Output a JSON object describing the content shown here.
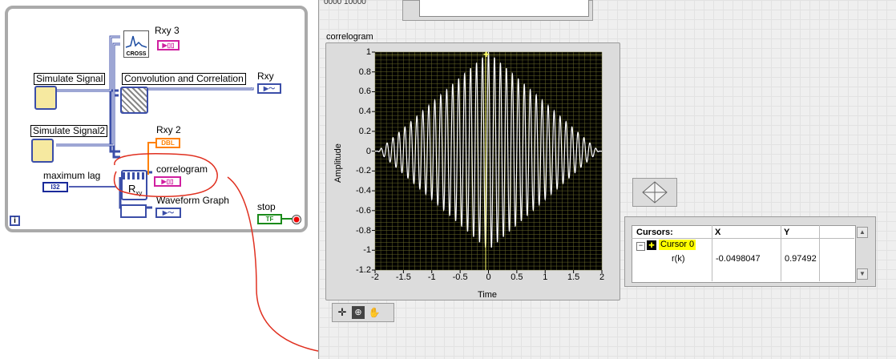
{
  "block_diagram": {
    "simulate_signal": "Simulate Signal",
    "simulate_signal2": "Simulate Signal2",
    "convolution": "Convolution and Correlation",
    "rxy3": "Rxy 3",
    "rxy": "Rxy",
    "rxy2": "Rxy 2",
    "correlogram": "correlogram",
    "maximum_lag": "maximum lag",
    "waveform_graph": "Waveform Graph",
    "stop": "stop",
    "cross_label": "CROSS",
    "rxy_node": "R",
    "rxy_node_sub": "xy",
    "i32": "I32",
    "dbl": "DBL",
    "tf": "TF",
    "info": "i"
  },
  "front_panel": {
    "top_field": "0000   10000",
    "graph_label": "correlogram",
    "y_axis_label": "Amplitude",
    "x_axis_label": "Time",
    "y_ticks": [
      "1",
      "0.8",
      "0.6",
      "0.4",
      "0.2",
      "0",
      "-0.2",
      "-0.4",
      "-0.6",
      "-0.8",
      "-1",
      "-1.2"
    ],
    "x_ticks": [
      "-2",
      "-1.5",
      "-1",
      "-0.5",
      "0",
      "0.5",
      "1",
      "1.5",
      "2"
    ],
    "cursors": {
      "header": "Cursors:",
      "col_x": "X",
      "col_y": "Y",
      "cursor_name": "Cursor 0",
      "plot_name": "r(k)",
      "x_value": "-0.0498047",
      "y_value": "0.97492"
    }
  },
  "chart_data": {
    "type": "line",
    "title": "correlogram",
    "xlabel": "Time",
    "ylabel": "Amplitude",
    "xlim": [
      -2,
      2
    ],
    "ylim": [
      -1.2,
      1
    ],
    "grid": true,
    "envelope_peak": {
      "x": 0,
      "y": 1
    },
    "envelope_edges": [
      {
        "x": -1.95,
        "y": 0
      },
      {
        "x": 1.95,
        "y": 0
      }
    ],
    "cursor": {
      "x": -0.0498047,
      "y": 0.97492
    }
  },
  "colors": {
    "plot_bg": "#000000",
    "grid": "#6a6a2a",
    "trace": "#ffffff",
    "cursor": "#ffff66",
    "annotation": "#e03020",
    "wire_cluster": "#3b4ea8",
    "wire_dbl": "#ff8000"
  }
}
